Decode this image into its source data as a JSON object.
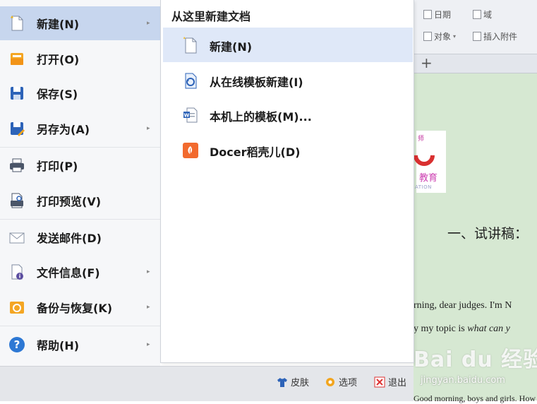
{
  "toolbar": {
    "items": [
      {
        "label": "日期",
        "icon": "calendar-icon"
      },
      {
        "label": "域",
        "icon": "field-icon"
      },
      {
        "label": "对象",
        "icon": "object-icon"
      },
      {
        "label": "插入附件",
        "icon": "attachment-icon"
      }
    ],
    "new_tab": "+"
  },
  "document": {
    "logo_text_top": "师",
    "logo_text_mid": "教育",
    "logo_text_bottom": "ATION",
    "heading": "一、试讲稿：",
    "lines": [
      {
        "text": "rning,  dear  judges.  I'm  N"
      },
      {
        "pre": "y my topic is ",
        "em": "what can y"
      },
      {
        "text": "Good morning, boys and girls. How"
      }
    ]
  },
  "menu": {
    "items": [
      {
        "label": "新建(N)",
        "icon": "new-file-icon",
        "submenu": true,
        "active": true
      },
      {
        "label": "打开(O)",
        "icon": "open-folder-icon",
        "submenu": false
      },
      {
        "label": "保存(S)",
        "icon": "save-icon",
        "submenu": false
      },
      {
        "label": "另存为(A)",
        "icon": "save-as-icon",
        "submenu": true
      },
      {
        "label": "打印(P)",
        "icon": "printer-icon",
        "submenu": false
      },
      {
        "label": "打印预览(V)",
        "icon": "print-preview-icon",
        "submenu": false
      },
      {
        "label": "发送邮件(D)",
        "icon": "envelope-icon",
        "submenu": false
      },
      {
        "label": "文件信息(F)",
        "icon": "file-info-icon",
        "submenu": true
      },
      {
        "label": "备份与恢复(K)",
        "icon": "backup-icon",
        "submenu": true
      },
      {
        "label": "帮助(H)",
        "icon": "help-icon",
        "submenu": true
      }
    ],
    "arrow": "▸"
  },
  "submenu": {
    "header": "从这里新建文档",
    "items": [
      {
        "label": "新建(N)",
        "icon": "new-blank-doc-icon",
        "active": true
      },
      {
        "label": "从在线模板新建(I)",
        "icon": "online-template-icon"
      },
      {
        "label": "本机上的模板(M)...",
        "icon": "local-template-icon"
      },
      {
        "label": "Docer稻壳儿(D)",
        "icon": "docer-icon"
      }
    ]
  },
  "bottombar": {
    "skin": "皮肤",
    "options": "选项",
    "exit": "退出"
  },
  "watermark": {
    "brand": "Bai du 经验",
    "url": "jingyan.baidu.com"
  },
  "colors": {
    "menu_active": "#c7d6ee",
    "submenu_active": "#dfe8f8",
    "document_bg": "#d6e8d2",
    "accent_blue": "#2f6fbf",
    "docer_orange": "#f26a2e"
  }
}
